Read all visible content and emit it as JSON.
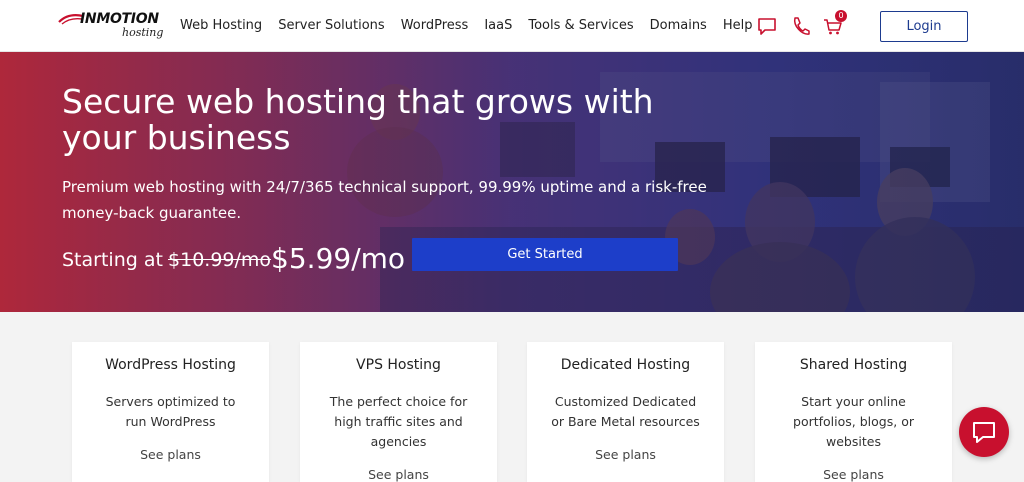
{
  "brand": {
    "logo_main": "INMOTION",
    "logo_sub": "hosting"
  },
  "nav": {
    "items": [
      {
        "label": "Web Hosting"
      },
      {
        "label": "Server Solutions"
      },
      {
        "label": "WordPress"
      },
      {
        "label": "IaaS"
      },
      {
        "label": "Tools & Services"
      },
      {
        "label": "Domains"
      },
      {
        "label": "Help"
      }
    ],
    "cart_count": "0",
    "login_label": "Login"
  },
  "hero": {
    "title": "Secure web hosting that grows with your business",
    "subtitle": "Premium web hosting with 24/7/365 technical support, 99.99% uptime and a risk-free money-back guarantee.",
    "price_label": "Starting at",
    "price_old": "$10.99/mo",
    "price_new": "$5.99/mo",
    "cta_label": "Get Started"
  },
  "cards": [
    {
      "title": "WordPress Hosting",
      "description": "Servers optimized to run WordPress",
      "more": "See plans"
    },
    {
      "title": "VPS Hosting",
      "description": "The perfect choice for high traffic sites and agencies",
      "more": "See plans"
    },
    {
      "title": "Dedicated Hosting",
      "description": "Customized Dedicated or Bare Metal resources",
      "more": "See plans"
    },
    {
      "title": "Shared Hosting",
      "description": "Start your online portfolios, blogs, or websites",
      "more": "See plans"
    }
  ],
  "colors": {
    "brand_red": "#c8102e",
    "brand_blue": "#1d3b8f",
    "cta_blue": "#1d3ec9"
  },
  "icons": [
    "chat-icon",
    "phone-icon",
    "cart-icon",
    "live-chat-icon"
  ]
}
